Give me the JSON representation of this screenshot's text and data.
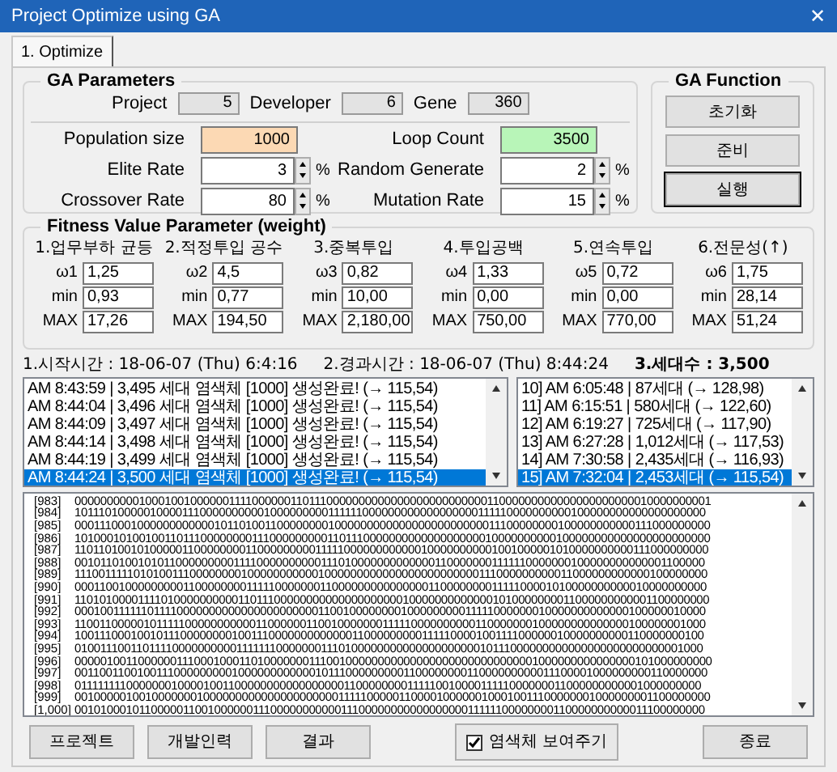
{
  "window": {
    "title": "Project Optimize using GA",
    "close": "✕"
  },
  "tabs": [
    {
      "label": "1. Optimize",
      "selected": true
    }
  ],
  "ga_parameters": {
    "title": "GA Parameters",
    "info": [
      {
        "label": "Project",
        "value": "5"
      },
      {
        "label": "Developer",
        "value": "6"
      },
      {
        "label": "Gene",
        "value": "360"
      }
    ],
    "fields": [
      {
        "label": "Population size",
        "value": "1000",
        "kind": "input",
        "color": "#fcd9b4"
      },
      {
        "label": "Loop Count",
        "value": "3500",
        "kind": "input",
        "color": "#b8f5b8"
      },
      {
        "label": "Elite Rate",
        "value": "3",
        "kind": "spin",
        "unit": "%"
      },
      {
        "label": "Random Generate",
        "value": "2",
        "kind": "spin",
        "unit": "%"
      },
      {
        "label": "Crossover Rate",
        "value": "80",
        "kind": "spin",
        "unit": "%"
      },
      {
        "label": "Mutation Rate",
        "value": "15",
        "kind": "spin",
        "unit": "%"
      }
    ]
  },
  "ga_function": {
    "title": "GA Function",
    "buttons": [
      {
        "label": "초기화",
        "selected": false
      },
      {
        "label": "준비",
        "selected": false
      },
      {
        "label": "실행",
        "selected": true
      }
    ]
  },
  "fitness": {
    "title": "Fitness Value Parameter (weight)",
    "columns": [
      {
        "header": "1.업무부하 균등",
        "w_label": "ω1",
        "w": "1,25",
        "min_label": "min",
        "min": "0,93",
        "max_label": "MAX",
        "max": "17,26"
      },
      {
        "header": "2.적정투입 공수",
        "w_label": "ω2",
        "w": "4,5",
        "min_label": "min",
        "min": "0,77",
        "max_label": "MAX",
        "max": "194,50"
      },
      {
        "header": "3.중복투입",
        "w_label": "ω3",
        "w": "0,82",
        "min_label": "min",
        "min": "10,00",
        "max_label": "MAX",
        "max": "2,180,00"
      },
      {
        "header": "4.투입공백",
        "w_label": "ω4",
        "w": "1,33",
        "min_label": "min",
        "min": "0,00",
        "max_label": "MAX",
        "max": "750,00"
      },
      {
        "header": "5.연속투입",
        "w_label": "ω5",
        "w": "0,72",
        "min_label": "min",
        "min": "0,00",
        "max_label": "MAX",
        "max": "770,00"
      },
      {
        "header": "6.전문성(↑)",
        "w_label": "ω6",
        "w": "1,75",
        "min_label": "min",
        "min": "28,14",
        "max_label": "MAX",
        "max": "51,24"
      }
    ]
  },
  "status": {
    "start": "1.시작시간 : 18-06-07 (Thu) 6:4:16",
    "elapsed": "2.경과시간 : 18-06-07 (Thu) 8:44:24",
    "generations": "3.세대수 : 3,500"
  },
  "log_list": [
    {
      "text": "AM 8:43:59 | 3,495 세대 염색체 [1000] 생성완료! (→ 115,54)",
      "selected": false
    },
    {
      "text": "AM 8:44:04 | 3,496 세대 염색체 [1000] 생성완료! (→ 115,54)",
      "selected": false
    },
    {
      "text": "AM 8:44:09 | 3,497 세대 염색체 [1000] 생성완료! (→ 115,54)",
      "selected": false
    },
    {
      "text": "AM 8:44:14 | 3,498 세대 염색체 [1000] 생성완료! (→ 115,54)",
      "selected": false
    },
    {
      "text": "AM 8:44:19 | 3,499 세대 염색체 [1000] 생성완료! (→ 115,54)",
      "selected": false
    },
    {
      "text": "AM 8:44:24 | 3,500 세대 염색체 [1000] 생성완료! (→ 115,54)",
      "selected": true
    }
  ],
  "best_list": [
    {
      "text": "10] AM 6:05:48 | 87세대 (→ 128,98)",
      "selected": false
    },
    {
      "text": "11] AM 6:15:51 | 580세대 (→ 122,60)",
      "selected": false
    },
    {
      "text": "12] AM 6:19:27 | 725세대 (→ 117,90)",
      "selected": false
    },
    {
      "text": "13] AM 6:27:28 | 1,012세대 (→ 117,53)",
      "selected": false
    },
    {
      "text": "14] AM 7:30:58 | 2,435세대 (→ 116,93)",
      "selected": false
    },
    {
      "text": "15] AM 7:32:04 | 2,453세대 (→ 115,54)",
      "selected": true
    }
  ],
  "chromosomes": [
    {
      "index": "[983]",
      "bits": "0000000000100010010000001111000000110111000000000000000000000000011000000000000000000000010000000001"
    },
    {
      "index": "[984]",
      "bits": "1011101000001000011100000000001000000000111111000000000000000000111110000000000100000000000000000000"
    },
    {
      "index": "[985]",
      "bits": "0001110001000000000000101101001100000000100000000000000000000000011100000000100000000000111000000000"
    },
    {
      "index": "[986]",
      "bits": "1010001010010011011100000000111000000000110111000000000000000000010000000000100000000000000000000000"
    },
    {
      "index": "[987]",
      "bits": "1101101001010000011000000001100000000011111000000000000100000000001001000001010000000000111000000000"
    },
    {
      "index": "[988]",
      "bits": "0010110100101011000000000111100000000001110100000000000001100000001111110000000100000000000001100000"
    },
    {
      "index": "[989]",
      "bits": "1110011111010100111000000001000000000001000000000000000000000000111000000000011000000000000100000000"
    },
    {
      "index": "[990]",
      "bits": "0001100100000000011000000001111100000001100000000000000011000000001111100001010000000000010000000000"
    },
    {
      "index": "[991]",
      "bits": "1101010000111101000000000011011100000000000000000000100000000000001010000000011000000000001100000000"
    },
    {
      "index": "[992]",
      "bits": "0001001111110111100000000000000000000001100100000000100000000011111000000010000000000000100000010000"
    },
    {
      "index": "[993]",
      "bits": "1100110000010111110000000000011000000110010000000111110000000000110000000100000000000000100000001000"
    },
    {
      "index": "[994]",
      "bits": "1001110001001011100000000100111000000000000011000000000111110000100111100000010000000000110000000100"
    },
    {
      "index": "[995]",
      "bits": "0100111001101111000000000011111110000000111010000000000000000000010111000000000000000000000000001000"
    },
    {
      "index": "[996]",
      "bits": "0000010011000000111000100011010000000111001000000000000000000000000000001000000000000000101000000000"
    },
    {
      "index": "[997]",
      "bits": "0011001100100111000000000100000000000010111000000000110000000011000000000011100001000000000110000000"
    },
    {
      "index": "[998]",
      "bits": "0111111110000000100001001100000000000000000110000000011111001000011111000000011000000000001000000000"
    },
    {
      "index": "[999]",
      "bits": "0010000010010000000100000000000000000000011111000001100001000000100010011100000001000000001100000000"
    },
    {
      "index": "[1,000]",
      "bits": "0010100010110000011001000000111000000000001110000000000000000011111100000000110000000000011100000000"
    }
  ],
  "bottom_buttons": [
    {
      "label": "프로젝트",
      "kind": "button"
    },
    {
      "label": "개발인력",
      "kind": "button"
    },
    {
      "label": "결과",
      "kind": "button"
    },
    {
      "label": "염색체 보여주기",
      "kind": "checkbox",
      "checked": true
    },
    {
      "label": "종료",
      "kind": "button"
    }
  ]
}
